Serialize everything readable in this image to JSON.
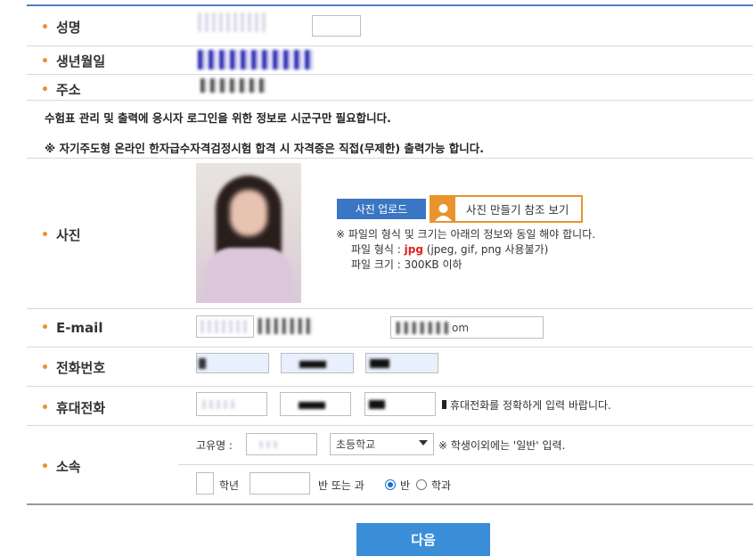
{
  "form": {
    "name_label": "성명",
    "birth_label": "생년월일",
    "address_label": "주소",
    "notice_1": "수험표 관리 및 출력에 응시자 로그인을 위한 정보로 시군구만 필요합니다.",
    "notice_2": "※ 자기주도형 온라인 한자급수자격검정시험 합격 시 자격증은 직접(무제한) 출력가능 합니다.",
    "photo_label": "사진",
    "email_label": "E-mail",
    "phone_label": "전화번호",
    "mobile_label": "휴대전화",
    "affiliation_label": "소속"
  },
  "photo": {
    "upload_button": "사진 업로드",
    "guide_button": "사진 만들기 참조 보기",
    "info_line1": "※ 파일의 형식 및 크기는 아래의 정보와 동일 해야 합니다.",
    "info_format_prefix": "파일 형식 : ",
    "info_format_value": "jpg",
    "info_format_suffix": " (jpeg, gif, png 사용불가)",
    "info_size": "파일 크기 : 300KB 이하"
  },
  "email": {
    "domain_value": "om"
  },
  "mobile": {
    "hint": "휴대전화를 정확하게 입력 바랍니다."
  },
  "affiliation": {
    "school_name_label": "고유명 :",
    "school_type_selected": "초등학교",
    "hint": "※ 학생이외에는 '일반' 입력.",
    "grade_label": "학년",
    "class_label": "반 또는 과",
    "radio_class": "반",
    "radio_dept": "학과",
    "selected_radio": "반"
  },
  "actions": {
    "next_button": "다음"
  },
  "colors": {
    "accent": "#3a76c4",
    "bullet": "#e8932b",
    "next_button": "#3a8ed8"
  }
}
